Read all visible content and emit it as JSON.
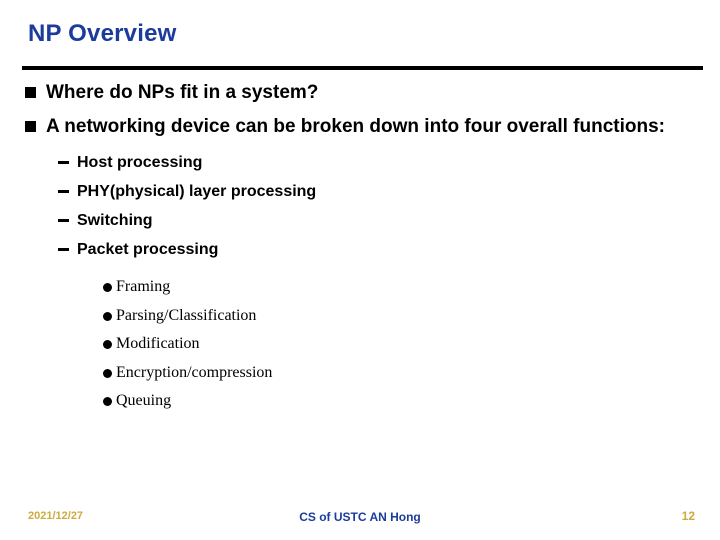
{
  "slide": {
    "title": "NP Overview",
    "title_color": "#1b3c9c",
    "rule_color": "#000000",
    "background": "#ffffff"
  },
  "content": {
    "level1": [
      {
        "text": "Where do NPs fit in a system?",
        "marker": "filled-square"
      },
      {
        "text": "A networking device can be broken down into four overall functions:",
        "marker": "filled-square"
      }
    ],
    "level2": [
      {
        "text": "Host processing",
        "marker": "dash"
      },
      {
        "text": "PHY(physical) layer processing",
        "marker": "dash"
      },
      {
        "text": "Switching",
        "marker": "dash"
      },
      {
        "text": "Packet processing",
        "marker": "dash"
      }
    ],
    "level3": [
      {
        "text": "Framing",
        "marker": "filled-circle"
      },
      {
        "text": "Parsing/Classification",
        "marker": "filled-circle"
      },
      {
        "text": "Modification",
        "marker": "filled-circle"
      },
      {
        "text": "Encryption/compression",
        "marker": "filled-circle"
      },
      {
        "text": "Queuing",
        "marker": "filled-circle"
      }
    ]
  },
  "footer": {
    "date": "2021/12/27",
    "center": "CS of USTC AN Hong",
    "page_number": "12",
    "accent_color": "#cdab3c",
    "center_color": "#1b3c9c"
  }
}
